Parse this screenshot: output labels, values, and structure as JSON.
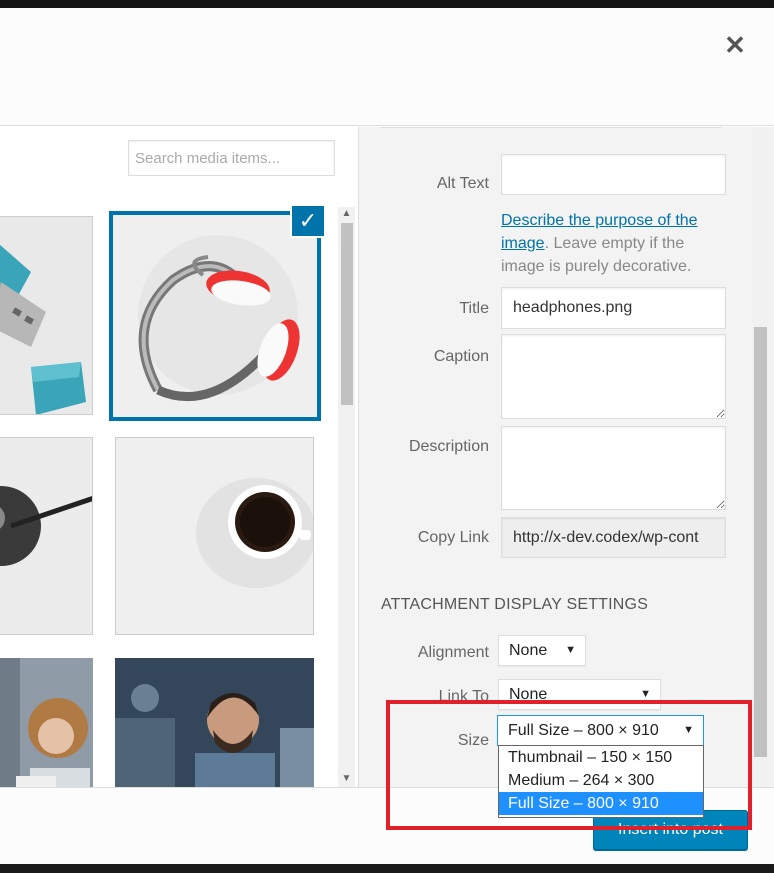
{
  "modal": {
    "close_symbol": "✕"
  },
  "browser": {
    "search_placeholder": "Search media items...",
    "selected_check": "✓",
    "thumbnails": [
      "usb-drive",
      "headphones",
      "cable",
      "coffee-cup",
      "woman-portrait",
      "man-smiling"
    ]
  },
  "sidebar": {
    "alt_text": {
      "label": "Alt Text",
      "value": ""
    },
    "help": {
      "link": "Describe the purpose of the image",
      "rest": ". Leave empty if the image is purely decorative."
    },
    "title": {
      "label": "Title",
      "value": "headphones.png"
    },
    "caption": {
      "label": "Caption",
      "value": ""
    },
    "description": {
      "label": "Description",
      "value": ""
    },
    "copy_link": {
      "label": "Copy Link",
      "value": "http://x-dev.codex/wp-cont"
    },
    "display_settings_title": "Attachment Display Settings",
    "alignment": {
      "label": "Alignment",
      "value": "None"
    },
    "link_to": {
      "label": "Link To",
      "value": "None"
    },
    "size": {
      "label": "Size",
      "value": "Full Size – 800 × 910",
      "options": [
        "Thumbnail – 150 × 150",
        "Medium – 264 × 300",
        "Full Size – 800 × 910"
      ],
      "selected_index": 2
    }
  },
  "toolbar": {
    "insert_label": "Insert into post"
  },
  "colors": {
    "accent": "#0073aa",
    "button": "#0085ba",
    "highlight_box": "#e0202a",
    "option_active": "#1e90ff"
  }
}
